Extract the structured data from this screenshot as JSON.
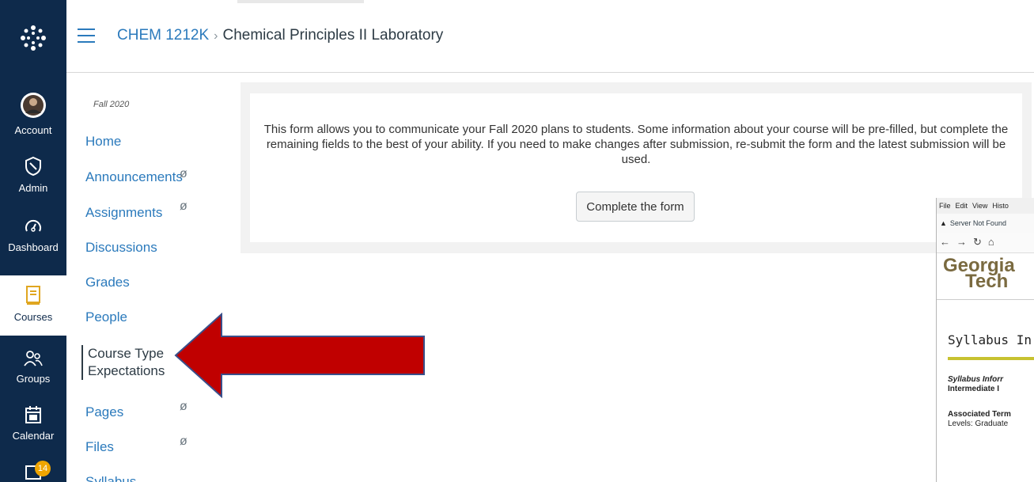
{
  "header": {
    "course_code": "CHEM 1212K",
    "separator": "›",
    "course_name": "Chemical Principles II Laboratory"
  },
  "global_nav": {
    "account": "Account",
    "admin": "Admin",
    "dashboard": "Dashboard",
    "courses": "Courses",
    "groups": "Groups",
    "calendar": "Calendar",
    "inbox_badge": "14"
  },
  "course_nav": {
    "term": "Fall 2020",
    "items": [
      {
        "label": "Home"
      },
      {
        "label": "Announcements"
      },
      {
        "label": "Assignments"
      },
      {
        "label": "Discussions"
      },
      {
        "label": "Grades"
      },
      {
        "label": "People"
      },
      {
        "label": "Course Type"
      },
      {
        "label": "Expectations"
      },
      {
        "label": "Pages"
      },
      {
        "label": "Files"
      },
      {
        "label": "Syllabus"
      }
    ],
    "hidden_icon": "ø"
  },
  "main": {
    "form_text": "This form allows you to communicate your Fall 2020 plans to students. Some information about your course will be pre-filled, but complete the remaining fields to the best of your ability. If you need to make changes after submission, re-submit the form and the latest submission will be used.",
    "form_button": "Complete the form"
  },
  "annotation": {
    "arrow_color": "#c00000",
    "arrow_border": "#3a4f8a"
  },
  "browser": {
    "menu": [
      "File",
      "Edit",
      "View",
      "Histo"
    ],
    "tab_title": "Server Not Found",
    "logo_line1": "Georgia",
    "logo_line2": "Tech",
    "heading": "Syllabus In",
    "line1": "Syllabus Inforr",
    "line2": "Intermediate I",
    "line3": "Associated Term",
    "line4": "Levels: Graduate"
  }
}
